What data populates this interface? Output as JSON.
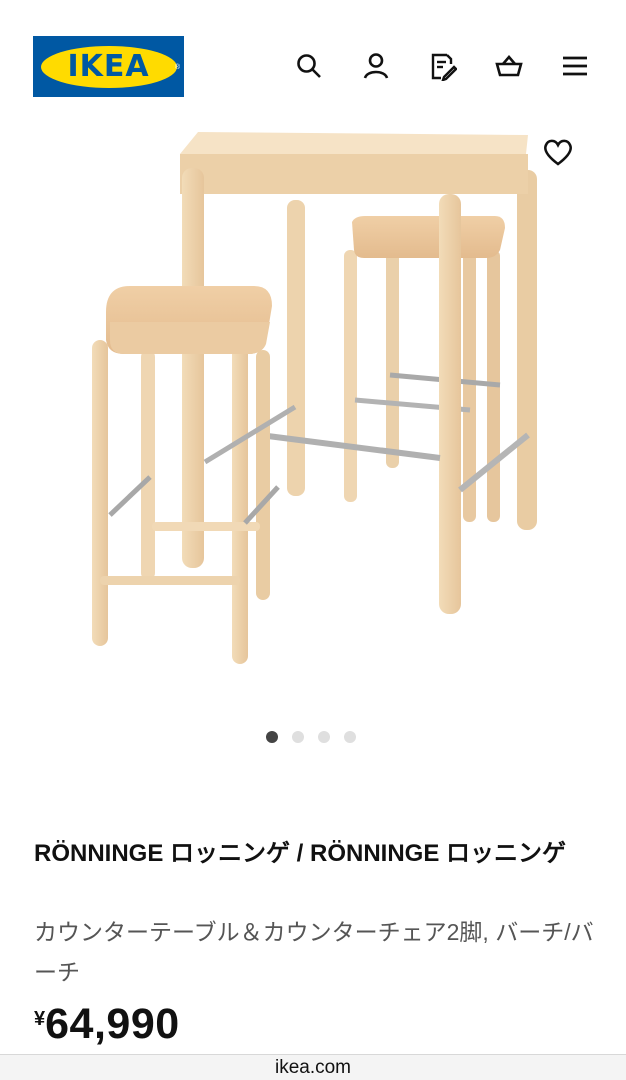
{
  "brand": {
    "logo_text": "IKEA",
    "registered": "®"
  },
  "header": {
    "icons": [
      "search-icon",
      "account-icon",
      "shopping-list-icon",
      "cart-icon",
      "menu-icon"
    ]
  },
  "gallery": {
    "image_alt": "",
    "active_index": 0,
    "total": 4
  },
  "product": {
    "name": "RÖNNINGE ロッニンゲ / RÖNNINGE ロッニンゲ",
    "description": "カウンターテーブル＆カウンターチェア2脚, バーチ/バーチ",
    "currency": "¥",
    "price": "64,990"
  },
  "browser": {
    "url": "ikea.com"
  },
  "colors": {
    "ikea_blue": "#0058a3",
    "ikea_yellow": "#ffdb00",
    "wood": "#e8c9a1"
  }
}
